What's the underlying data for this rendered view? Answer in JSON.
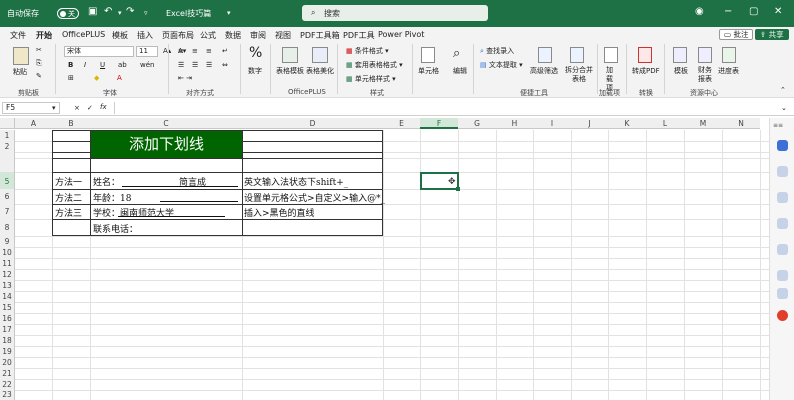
{
  "titlebar": {
    "autosave": "自动保存",
    "toggle": "关",
    "filename": "Excel技巧篇",
    "search_placeholder": "搜索"
  },
  "menu": {
    "items": [
      "文件",
      "开始",
      "OfficePLUS",
      "模板",
      "插入",
      "页面布局",
      "公式",
      "数据",
      "审阅",
      "视图",
      "PDF工具箱",
      "PDF工具",
      "Power Pivot"
    ],
    "comment": "批注",
    "share": "共享"
  },
  "ribbon": {
    "paste": "粘贴",
    "clipboard": "剪贴板",
    "font_name": "宋体",
    "font_size": "11",
    "bold": "B",
    "italic": "I",
    "underline": "U",
    "wen": "wén",
    "font_group": "字体",
    "align_group": "对齐方式",
    "number": "数字",
    "number_pct": "%",
    "table_template": "表格模板",
    "table_beautify": "表格美化",
    "officeplus_group": "OfficePLUS",
    "cond_format": "条件格式",
    "table_format": "套用表格格式",
    "cell_style": "单元格样式",
    "style_group": "样式",
    "cells": "单元格",
    "edit": "编辑",
    "find_input": "查找录入",
    "text_extract": "文本提取",
    "adv_filter": "高级筛选",
    "split_merge": "拆分合并表格",
    "quick_group": "便捷工具",
    "load": "加载项",
    "load_group": "加载项",
    "to_pdf": "转成PDF",
    "convert_group": "转换",
    "template": "模板",
    "finance": "财务报表",
    "progress": "进度表",
    "resource_group": "资源中心"
  },
  "formula": {
    "namebox": "F5",
    "fx": "fx",
    "cancel": "×",
    "confirm": "✓"
  },
  "columns": [
    "A",
    "B",
    "C",
    "D",
    "E",
    "F",
    "G",
    "H",
    "I",
    "J",
    "K",
    "L",
    "M",
    "N"
  ],
  "rows": [
    "1",
    "2",
    "5",
    "6",
    "7",
    "8",
    "9",
    "10",
    "11",
    "12",
    "13",
    "14",
    "15",
    "16",
    "17",
    "18",
    "19",
    "20",
    "21",
    "22",
    "23"
  ],
  "sheet": {
    "title": "添加下划线",
    "b5": "方法一",
    "c5_label": "姓名：",
    "c5_name": "简言成",
    "d5": "英文输入法状态下shift+_",
    "b6": "方法二",
    "c6_label": "年龄：18",
    "d6": "设置单元格公式>自定义>输入@*_",
    "b7": "方法三",
    "c7_label": "学校：",
    "c7_school": "闽南师范大学",
    "d7": "插入>黑色的直线",
    "c8": "联系电话："
  },
  "colors": {
    "excel_green": "#1e7145",
    "title_fill": "#006400",
    "title_text": "#ffffff"
  }
}
